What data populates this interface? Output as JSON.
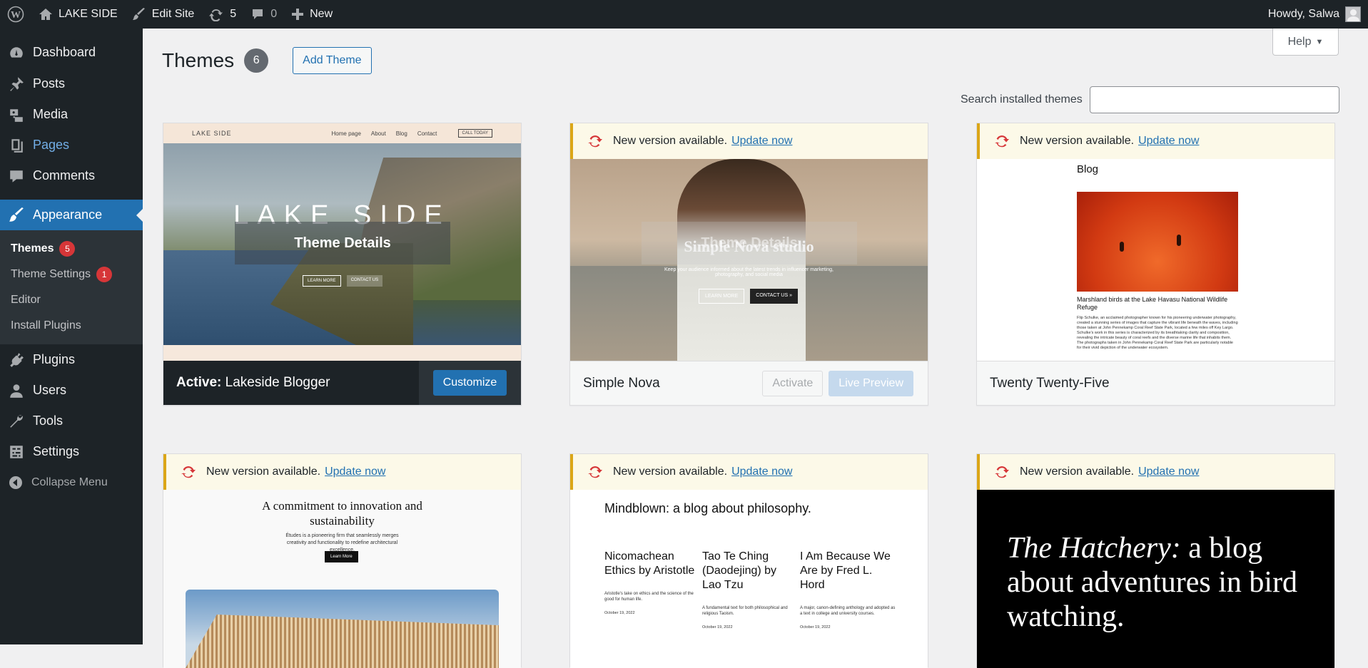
{
  "adminbar": {
    "site_name": "LAKE SIDE",
    "edit_site": "Edit Site",
    "updates_count": "5",
    "comments_count": "0",
    "new_label": "New",
    "howdy": "Howdy, Salwa"
  },
  "sidebar": {
    "items": [
      {
        "label": "Dashboard"
      },
      {
        "label": "Posts"
      },
      {
        "label": "Media"
      },
      {
        "label": "Pages"
      },
      {
        "label": "Comments"
      },
      {
        "label": "Appearance"
      }
    ],
    "submenu": [
      {
        "label": "Themes",
        "badge": "5"
      },
      {
        "label": "Theme Settings",
        "badge": "1"
      },
      {
        "label": "Editor"
      },
      {
        "label": "Install Plugins"
      }
    ],
    "items_after": [
      {
        "label": "Plugins"
      },
      {
        "label": "Users"
      },
      {
        "label": "Tools"
      },
      {
        "label": "Settings"
      }
    ],
    "collapse": "Collapse Menu"
  },
  "header": {
    "title": "Themes",
    "count": "6",
    "add_button": "Add Theme",
    "help": "Help"
  },
  "search": {
    "label": "Search installed themes",
    "value": ""
  },
  "notice": {
    "text": "New version available.",
    "link": "Update now"
  },
  "themes": [
    {
      "name": "Lakeside Blogger",
      "active_label": "Active:",
      "customize": "Customize",
      "overlay": "Theme Details",
      "preview": {
        "logo": "LAKE SIDE",
        "nav": [
          "Home page",
          "About",
          "Blog",
          "Contact"
        ],
        "cta": "CALL TODAY",
        "hero": "LAKE SIDE",
        "btn1": "LEARN MORE",
        "btn2": "CONTACT US"
      }
    },
    {
      "name": "Simple Nova",
      "activate": "Activate",
      "live_preview": "Live Preview",
      "overlay": "Theme Details",
      "preview": {
        "hero": "Simple Nova studio",
        "sub": "Keep your audience informed about the latest trends in influencer marketing, photography, and social media",
        "btn1": "LEARN MORE",
        "btn2": "CONTACT US »"
      }
    },
    {
      "name": "Twenty Twenty-Five",
      "preview": {
        "heading": "Blog",
        "caption": "Marshland birds at the Lake Havasu National Wildlife Refuge",
        "body": "Flip Schulke, an acclaimed photographer known for his pioneering underwater photography, created a stunning series of images that capture the vibrant life beneath the waves, including those taken at John Pennekamp Coral Reef State Park, located a few miles off Key Largo. Schulke's work in this series is characterized by its breathtaking clarity and composition, revealing the intricate beauty of coral reefs and the diverse marine life that inhabits them. The photographs taken in John Pennekamp Coral Reef State Park are particularly notable for their vivid depiction of the underwater ecosystem."
      }
    },
    {
      "preview": {
        "heading": "A commitment to innovation and sustainability",
        "sub": "Études is a pioneering firm that seamlessly merges creativity and functionality to redefine architectural excellence.",
        "btn": "Learn More"
      }
    },
    {
      "preview": {
        "heading": "Mindblown: a blog about philosophy.",
        "posts": [
          {
            "title": "Nicomachean Ethics by Aristotle",
            "excerpt": "Aristotle's take on ethics and the science of the good for human life.",
            "date": "October 19, 2022"
          },
          {
            "title": "Tao Te Ching (Daodejing) by Lao Tzu",
            "excerpt": "A fundamental text for both philosophical and religious Taoism.",
            "date": "October 19, 2022"
          },
          {
            "title": "I Am Because We Are by Fred L. Hord",
            "excerpt": "A major, canon-defining anthology and adopted as a text in college and university courses.",
            "date": "October 19, 2022"
          }
        ]
      }
    },
    {
      "preview": {
        "italic": "The Hatchery:",
        "rest": " a blog about adventures in bird watching."
      }
    }
  ],
  "colors": {
    "admin_dark": "#1d2327",
    "accent": "#2271b1",
    "notice_bg": "#fcf9e8",
    "notice_border": "#dba617",
    "badge": "#d63638"
  }
}
